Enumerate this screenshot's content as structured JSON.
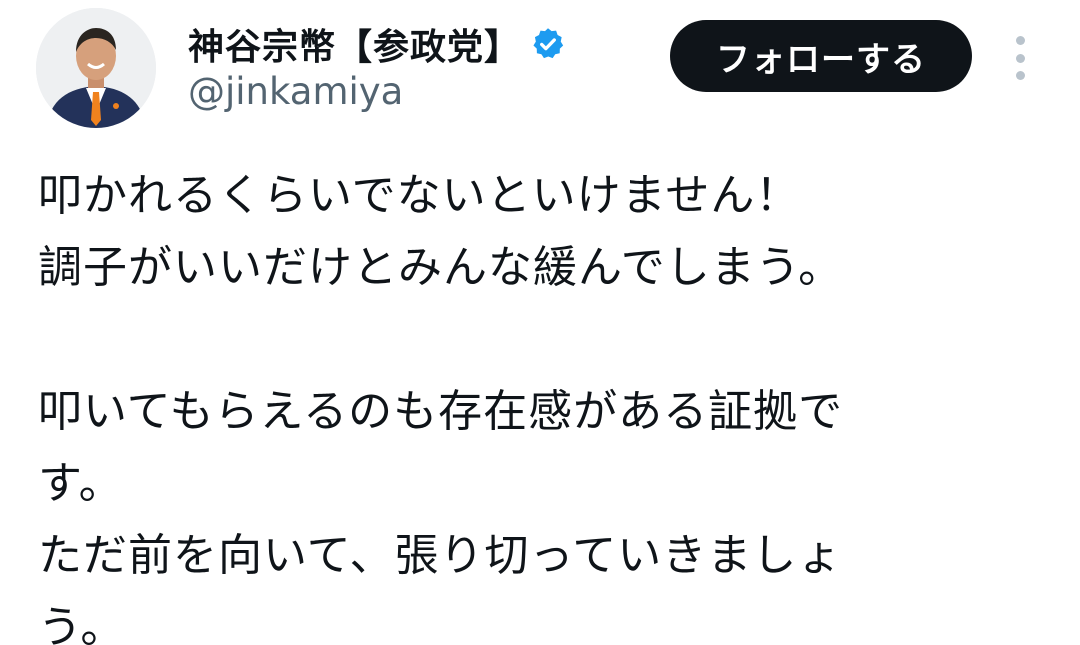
{
  "header": {
    "display_name": "神谷宗幣【参政党】",
    "handle": "@jinkamiya",
    "verified_icon": "verified-badge-icon",
    "verified_color": "#1d9bf0",
    "follow_label": "フォローする",
    "more_icon": "more-vertical-icon"
  },
  "tweet": {
    "lines": [
      "叩かれるくらいでないといけません！",
      "調子がいいだけとみんな緩んでしまう。",
      "",
      "叩いてもらえるのも存在感がある証拠で",
      "す。",
      "ただ前を向いて、張り切っていきましょ",
      "う。"
    ]
  }
}
